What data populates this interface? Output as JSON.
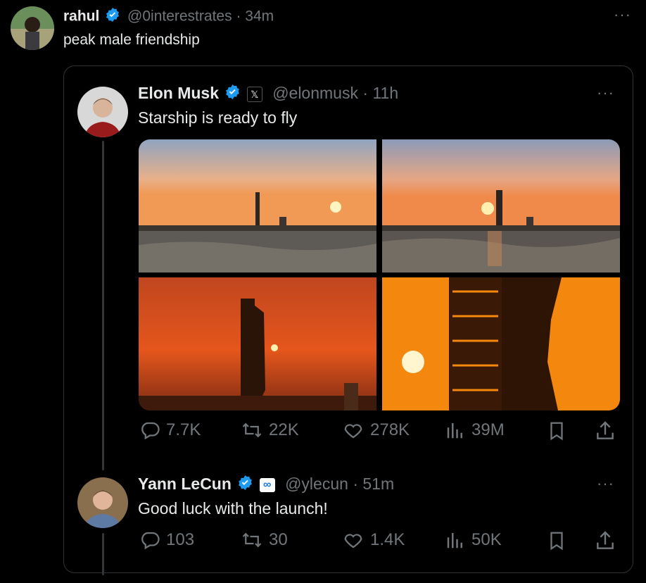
{
  "outer_tweet": {
    "name": "rahul",
    "handle": "@0interestrates",
    "sep": "·",
    "time": "34m",
    "text": "peak male friendship",
    "more_label": "···"
  },
  "quoted_tweet": {
    "name": "Elon Musk",
    "handle": "@elonmusk",
    "sep": "·",
    "time": "11h",
    "text": "Starship is ready to fly",
    "affiliate_badge": "𝕏",
    "more_label": "···",
    "actions": {
      "replies": "7.7K",
      "reposts": "22K",
      "likes": "278K",
      "views": "39M"
    },
    "images": [
      {
        "icon": "sunset-photo-1"
      },
      {
        "icon": "sunset-photo-2"
      },
      {
        "icon": "sunset-photo-3"
      },
      {
        "icon": "sunset-photo-4"
      }
    ]
  },
  "reply_tweet": {
    "name": "Yann LeCun",
    "handle": "@ylecun",
    "sep": "·",
    "time": "51m",
    "text": "Good luck with the launch!",
    "affiliate_badge": "∞",
    "more_label": "···",
    "actions": {
      "replies": "103",
      "reposts": "30",
      "likes": "1.4K",
      "views": "50K"
    }
  },
  "colors": {
    "background": "#000000",
    "text": "#e7e9ea",
    "muted": "#71767b",
    "verified": "#1d9bf0",
    "border": "#2f3336"
  }
}
